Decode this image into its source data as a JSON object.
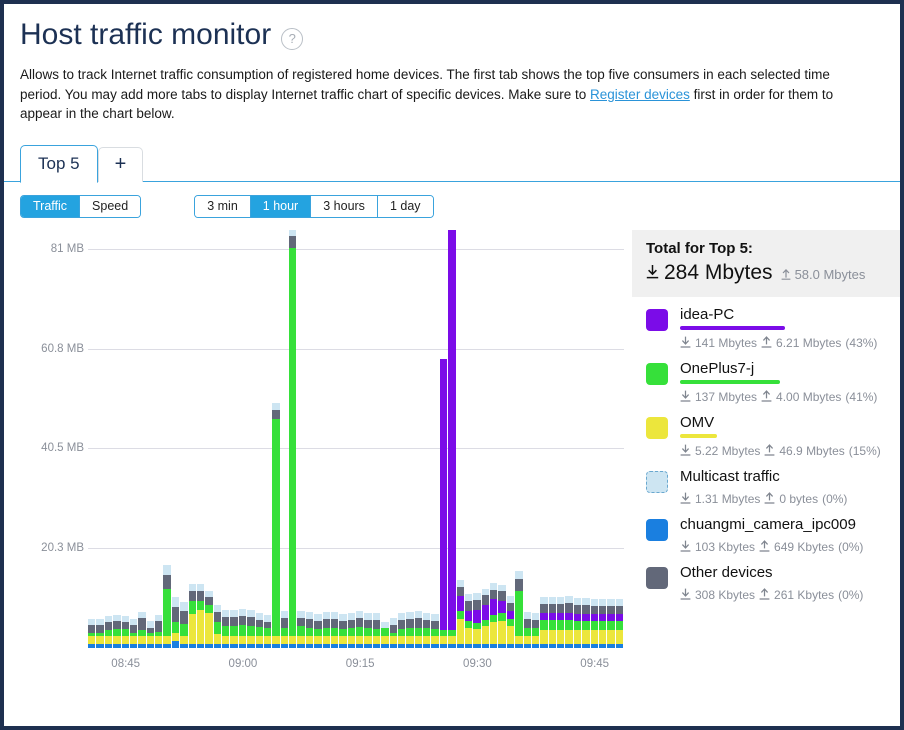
{
  "header": {
    "title": "Host traffic monitor",
    "help_icon": "help-circle-icon",
    "description_part1": "Allows to track Internet traffic consumption of registered home devices. The first tab shows the top five consumers in each selected time period. You may add more tabs to display Internet traffic chart of specific devices. Make sure to ",
    "description_link": "Register devices",
    "description_part2": " first in order for them to appear in the chart below."
  },
  "tabs": [
    {
      "label": "Top 5",
      "active": true
    },
    {
      "label": "+",
      "active": false
    }
  ],
  "controls": {
    "metric_toggle": {
      "options": [
        "Traffic",
        "Speed"
      ],
      "selected": "Traffic"
    },
    "period_toggle": {
      "options": [
        "3 min",
        "1 hour",
        "3 hours",
        "1 day"
      ],
      "selected": "1 hour"
    }
  },
  "legend": {
    "total_title": "Total for Top 5:",
    "total_download": "284 Mbytes",
    "total_upload": "58.0 Mbytes",
    "download_icon": "download-arrow-icon",
    "upload_icon": "upload-arrow-icon",
    "items": [
      {
        "name": "idea-PC",
        "color": "#7b0ce8",
        "download": "141 Mbytes",
        "upload": "6.21 Mbytes",
        "percent": "(43%)",
        "meter_pct": 43,
        "meter": true,
        "dashed": false
      },
      {
        "name": "OnePlus7-j",
        "color": "#36e03a",
        "download": "137 Mbytes",
        "upload": "4.00 Mbytes",
        "percent": "(41%)",
        "meter_pct": 41,
        "meter": true,
        "dashed": false
      },
      {
        "name": "OMV",
        "color": "#ece63c",
        "download": "5.22 Mbytes",
        "upload": "46.9 Mbytes",
        "percent": "(15%)",
        "meter_pct": 15,
        "meter": true,
        "dashed": false
      },
      {
        "name": "Multicast traffic",
        "color": "#cde5f2",
        "download": "1.31 Mbytes",
        "upload": "0 bytes",
        "percent": "(0%)",
        "meter_pct": 0,
        "meter": false,
        "dashed": true
      },
      {
        "name": "chuangmi_camera_ipc009",
        "color": "#1a7fe0",
        "download": "103 Kbytes",
        "upload": "649 Kbytes",
        "percent": "(0%)",
        "meter_pct": 0,
        "meter": false,
        "dashed": false
      },
      {
        "name": "Other devices",
        "color": "#626879",
        "download": "308 Kbytes",
        "upload": "261 Kbytes",
        "percent": "(0%)",
        "meter_pct": 0,
        "meter": false,
        "dashed": false
      }
    ]
  },
  "chart_data": {
    "type": "bar",
    "stacked": true,
    "title": "",
    "xlabel": "",
    "ylabel": "",
    "ylim": [
      0,
      85
    ],
    "grid": true,
    "legend_position": "right",
    "ytick_values": [
      20.3,
      40.5,
      60.8,
      81
    ],
    "ytick_labels": [
      "20.3 MB",
      "40.5 MB",
      "60.8 MB",
      "81 MB"
    ],
    "xtick_labels": [
      "08:45",
      "09:00",
      "09:15",
      "09:30",
      "09:45"
    ],
    "xtick_positions": [
      4,
      18,
      32,
      46,
      60
    ],
    "series": [
      {
        "name": "chuangmi_camera_ipc009",
        "color": "#1a7fe0",
        "values": [
          0.8,
          0.8,
          0.8,
          0.8,
          0.8,
          0.8,
          0.8,
          0.8,
          0.8,
          0.8,
          1.4,
          0.8,
          0.8,
          0.8,
          0.8,
          0.8,
          0.8,
          0.8,
          0.8,
          0.8,
          0.8,
          0.8,
          0.8,
          0.8,
          0.8,
          0.8,
          0.8,
          0.8,
          0.8,
          0.8,
          0.8,
          0.8,
          0.8,
          0.8,
          0.8,
          0.8,
          0.8,
          0.8,
          0.8,
          0.8,
          0.8,
          0.8,
          0.8,
          0.8,
          0.8,
          0.8,
          0.8,
          0.8,
          0.8,
          0.8,
          0.8,
          0.8,
          0.8,
          0.8,
          0.8,
          0.8,
          0.8,
          0.8,
          0.8,
          0.8,
          0.8,
          0.8,
          0.8,
          0.8
        ]
      },
      {
        "name": "OMV",
        "color": "#ece63c",
        "values": [
          1.6,
          1.6,
          1.6,
          1.6,
          1.6,
          1.6,
          1.6,
          1.6,
          1.6,
          1.6,
          1.6,
          1.6,
          6.0,
          6.8,
          6.3,
          2.0,
          1.6,
          1.6,
          1.6,
          1.6,
          1.6,
          1.6,
          1.6,
          1.6,
          1.6,
          1.6,
          1.6,
          1.6,
          1.6,
          1.6,
          1.6,
          1.6,
          1.6,
          1.6,
          1.6,
          1.6,
          1.6,
          1.6,
          1.6,
          1.6,
          1.6,
          1.6,
          1.6,
          1.6,
          5.0,
          3.2,
          3.0,
          3.6,
          4.4,
          4.6,
          3.6,
          1.6,
          1.6,
          1.6,
          2.8,
          2.8,
          2.8,
          2.8,
          2.8,
          2.8,
          2.8,
          2.8,
          2.8,
          2.8
        ]
      },
      {
        "name": "OnePlus7-j",
        "color": "#36e03a",
        "values": [
          0.6,
          0.6,
          1.2,
          1.4,
          1.4,
          0.6,
          1.2,
          0.6,
          0.8,
          9.6,
          2.2,
          2.4,
          2.6,
          1.8,
          1.6,
          2.4,
          2.0,
          2.0,
          2.2,
          2.0,
          1.8,
          1.6,
          44.0,
          1.6,
          79.5,
          2.0,
          1.6,
          1.4,
          1.6,
          1.6,
          1.4,
          1.6,
          1.8,
          1.6,
          1.4,
          1.6,
          0.6,
          1.4,
          1.6,
          1.6,
          1.6,
          1.4,
          1.2,
          1.2,
          1.6,
          1.4,
          1.2,
          1.2,
          1.4,
          1.6,
          1.4,
          9.0,
          1.6,
          1.6,
          2.0,
          2.0,
          2.0,
          2.0,
          1.8,
          1.8,
          1.8,
          1.8,
          1.8,
          1.8
        ]
      },
      {
        "name": "idea-PC",
        "color": "#7b0ce8",
        "values": [
          0,
          0,
          0,
          0,
          0,
          0,
          0,
          0,
          0,
          0,
          0,
          0,
          0,
          0,
          0,
          0,
          0,
          0,
          0,
          0,
          0,
          0,
          0,
          0,
          0,
          0,
          0,
          0,
          0,
          0,
          0,
          0,
          0,
          0,
          0,
          0,
          0,
          0,
          0,
          0,
          0,
          0,
          55.0,
          83.0,
          3.0,
          2.0,
          2.6,
          3.0,
          3.2,
          2.4,
          1.6,
          0,
          0,
          0,
          1.4,
          1.4,
          1.4,
          1.4,
          1.4,
          1.4,
          1.4,
          1.4,
          1.4,
          1.4
        ]
      },
      {
        "name": "Other devices",
        "color": "#626879",
        "values": [
          1.6,
          1.6,
          1.6,
          1.6,
          1.4,
          1.6,
          2.4,
          1.0,
          2.2,
          2.8,
          3.0,
          2.6,
          2.0,
          2.0,
          1.6,
          2.0,
          1.8,
          1.8,
          1.8,
          1.8,
          1.4,
          1.2,
          2.0,
          2.0,
          2.4,
          1.6,
          1.8,
          1.6,
          1.8,
          1.8,
          1.6,
          1.6,
          1.8,
          1.6,
          1.8,
          0.0,
          1.6,
          1.8,
          1.8,
          2.0,
          1.6,
          1.6,
          0.0,
          0.0,
          2.0,
          2.0,
          2.0,
          2.0,
          2.0,
          2.0,
          1.6,
          2.6,
          1.8,
          1.6,
          1.8,
          1.8,
          1.8,
          2.0,
          1.8,
          1.8,
          1.6,
          1.6,
          1.6,
          1.6
        ]
      },
      {
        "name": "Multicast traffic",
        "color": "#cde5f2",
        "values": [
          1.2,
          1.2,
          1.2,
          1.2,
          1.2,
          1.2,
          1.2,
          1.4,
          1.2,
          2.0,
          2.0,
          1.8,
          1.6,
          1.6,
          1.2,
          1.4,
          1.4,
          1.4,
          1.4,
          1.4,
          1.4,
          1.4,
          1.4,
          1.4,
          1.4,
          1.4,
          1.4,
          1.4,
          1.4,
          1.4,
          1.4,
          1.4,
          1.4,
          1.4,
          1.4,
          1.2,
          1.4,
          1.4,
          1.4,
          1.4,
          1.4,
          1.4,
          0.0,
          0.0,
          1.4,
          1.4,
          1.4,
          1.4,
          1.4,
          1.4,
          1.4,
          1.6,
          1.4,
          1.4,
          1.4,
          1.4,
          1.4,
          1.4,
          1.4,
          1.4,
          1.4,
          1.4,
          1.4,
          1.4
        ]
      }
    ]
  }
}
